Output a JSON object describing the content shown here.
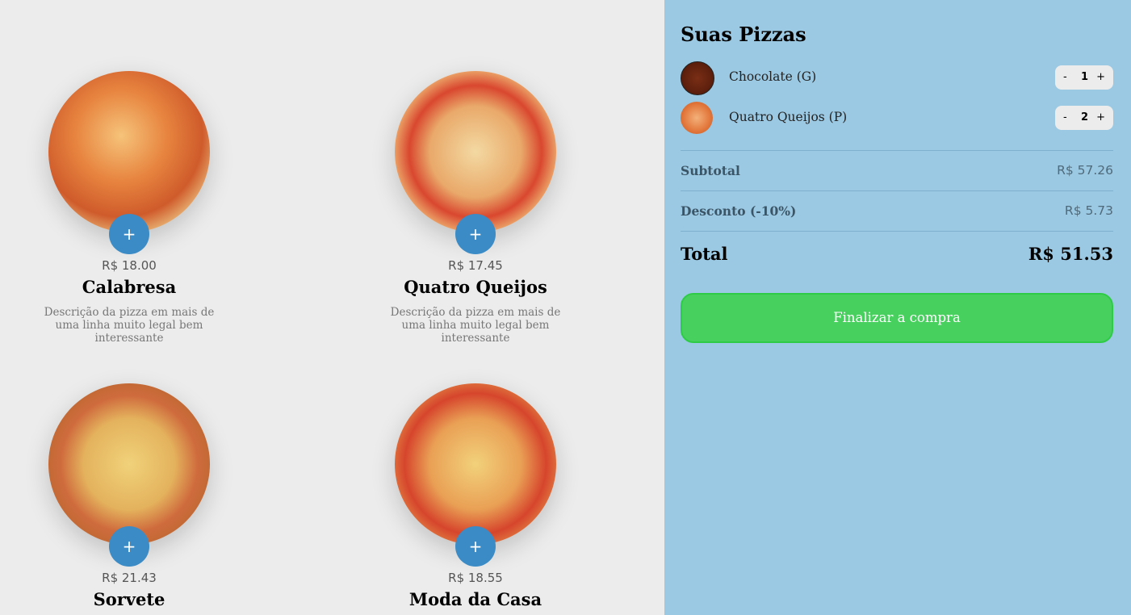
{
  "menu": {
    "add_label": "+",
    "pizzas": [
      {
        "price": "R$ 18.00",
        "name": "Calabresa",
        "description": "Descrição da pizza em mais de uma linha muito legal bem interessante",
        "image": "pizza-calabresa"
      },
      {
        "price": "R$ 17.45",
        "name": "Quatro Queijos",
        "description": "Descrição da pizza em mais de uma linha muito legal bem interessante",
        "image": "pizza-quatro-queijos"
      },
      {
        "price": "R$ 21.43",
        "name": "Sorvete",
        "description": "",
        "image": "pizza-sorvete"
      },
      {
        "price": "R$ 18.55",
        "name": "Moda da Casa",
        "description": "",
        "image": "pizza-moda-da-casa"
      }
    ]
  },
  "cart": {
    "title": "Suas Pizzas",
    "items": [
      {
        "name": "Chocolate (G)",
        "qty": "1",
        "minus": "-",
        "plus": "+"
      },
      {
        "name": "Quatro Queijos (P)",
        "qty": "2",
        "minus": "-",
        "plus": "+"
      }
    ],
    "subtotal_label": "Subtotal",
    "subtotal_value": "R$ 57.26",
    "discount_label": "Desconto (-10%)",
    "discount_value": "R$ 5.73",
    "total_label": "Total",
    "total_value": "R$ 51.53",
    "checkout_label": "Finalizar a compra"
  },
  "colors": {
    "menu_bg": "#ececec",
    "cart_bg": "#9bc9e3",
    "add_button": "#3a8bc6",
    "checkout_button": "#48d05f"
  }
}
